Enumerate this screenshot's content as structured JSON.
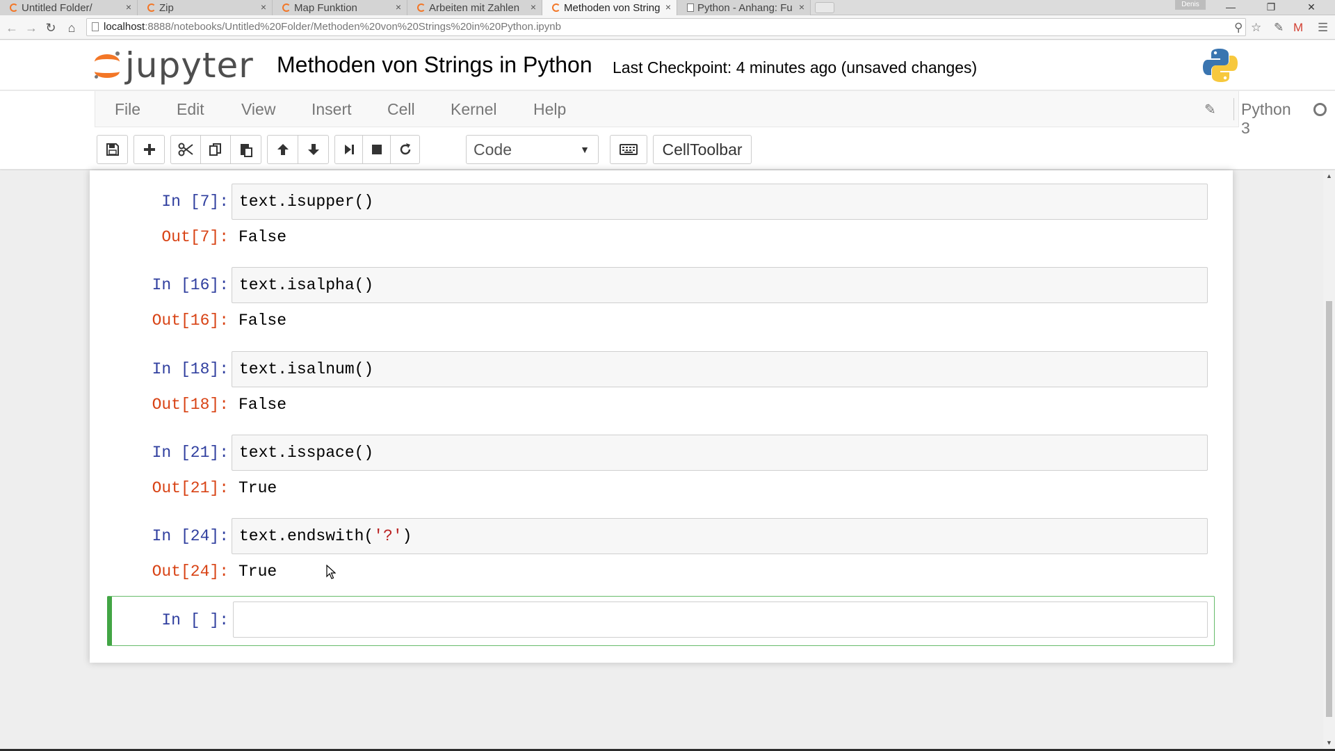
{
  "browser": {
    "tabs": [
      {
        "label": "Untitled Folder/",
        "icon": "jupyter-favicon",
        "active": false
      },
      {
        "label": "Zip",
        "icon": "jupyter-favicon",
        "active": false
      },
      {
        "label": "Map Funktion",
        "icon": "jupyter-favicon",
        "active": false
      },
      {
        "label": "Arbeiten mit Zahlen",
        "icon": "jupyter-favicon",
        "active": false
      },
      {
        "label": "Methoden von String",
        "icon": "jupyter-favicon",
        "active": true
      },
      {
        "label": "Python - Anhang: Fu",
        "icon": "document-icon",
        "active": false
      }
    ],
    "tab_close_glyph": "×",
    "user_label": "Denis",
    "url_host": "localhost",
    "url_path": ":8888/notebooks/Untitled%20Folder/Methoden%20von%20Strings%20in%20Python.ipynb"
  },
  "header": {
    "logo_text": "jupyter",
    "notebook_title": "Methoden von Strings in Python",
    "checkpoint": "Last Checkpoint: 4 minutes ago (unsaved changes)"
  },
  "menubar": {
    "items": [
      "File",
      "Edit",
      "View",
      "Insert",
      "Cell",
      "Kernel",
      "Help"
    ],
    "kernel_name": "Python 3"
  },
  "toolbar": {
    "cell_type": "Code",
    "celltoolbar_label": "CellToolbar"
  },
  "cells": [
    {
      "in_prompt": "In [7]:",
      "code": "text.isupper()",
      "out_prompt": "Out[7]:",
      "output": "False"
    },
    {
      "in_prompt": "In [16]:",
      "code": "text.isalpha()",
      "out_prompt": "Out[16]:",
      "output": "False"
    },
    {
      "in_prompt": "In [18]:",
      "code": "text.isalnum()",
      "out_prompt": "Out[18]:",
      "output": "False"
    },
    {
      "in_prompt": "In [21]:",
      "code": "text.isspace()",
      "out_prompt": "Out[21]:",
      "output": "True"
    },
    {
      "in_prompt": "In [24]:",
      "code_prefix": "text.endswith(",
      "code_string": "'?'",
      "code_suffix": ")",
      "out_prompt": "Out[24]:",
      "output": "True"
    }
  ],
  "active_cell": {
    "in_prompt": "In [ ]:",
    "code": ""
  },
  "colors": {
    "jupyter_orange": "#f37626",
    "in_prompt": "#303f9f",
    "out_prompt": "#d84315",
    "active_border": "#42a545",
    "string_literal": "#ba2121"
  }
}
